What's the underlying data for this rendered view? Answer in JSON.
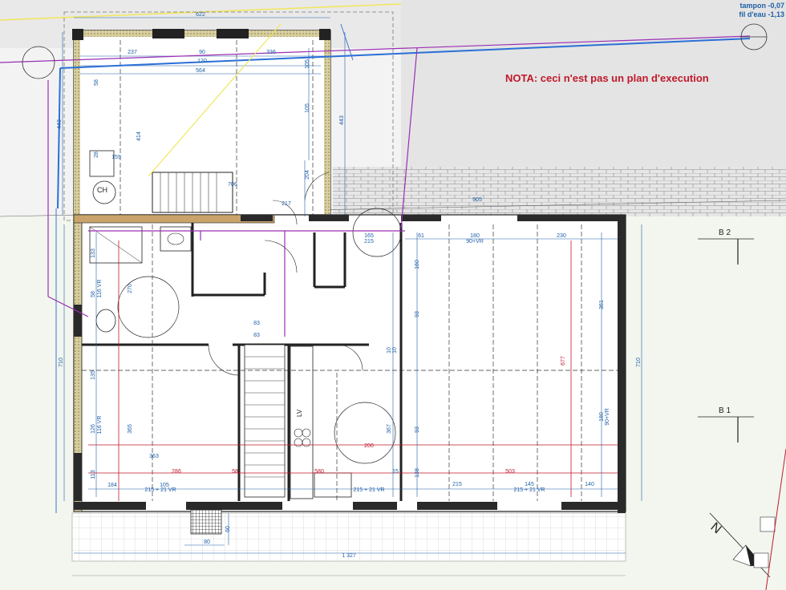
{
  "nota": "NOTA: ceci n'est pas un plan d'execution",
  "tampon": {
    "line1": "tampon -0,07",
    "line2": "fil d'eau -1,13"
  },
  "sections": {
    "b2": "B 2",
    "b1": "B 1"
  },
  "north": "N",
  "labels": {
    "ch": "CH",
    "lv": "LV"
  },
  "dims_blue": [
    {
      "t": "622"
    },
    {
      "t": "237"
    },
    {
      "t": "90"
    },
    {
      "t": "120"
    },
    {
      "t": "336"
    },
    {
      "t": "564"
    },
    {
      "t": "443"
    },
    {
      "t": "414"
    },
    {
      "t": "105"
    },
    {
      "t": "105"
    },
    {
      "t": "443"
    },
    {
      "t": "58"
    },
    {
      "t": "28"
    },
    {
      "t": "159"
    },
    {
      "t": "204"
    },
    {
      "t": "706"
    },
    {
      "t": "217"
    },
    {
      "t": "905"
    },
    {
      "t": "61"
    },
    {
      "t": "180"
    },
    {
      "t": "90+VR"
    },
    {
      "t": "230"
    },
    {
      "t": "165"
    },
    {
      "t": "215"
    },
    {
      "t": "133"
    },
    {
      "t": "270"
    },
    {
      "t": "58"
    },
    {
      "t": "116 VR"
    },
    {
      "t": "160"
    },
    {
      "t": "93"
    },
    {
      "t": "361"
    },
    {
      "t": "710"
    },
    {
      "t": "710"
    },
    {
      "t": "135"
    },
    {
      "t": "365"
    },
    {
      "t": "83"
    },
    {
      "t": "83"
    },
    {
      "t": "10"
    },
    {
      "t": "10"
    },
    {
      "t": "367"
    },
    {
      "t": "93"
    },
    {
      "t": "126"
    },
    {
      "t": "116 VR"
    },
    {
      "t": "180"
    },
    {
      "t": "90+VR"
    },
    {
      "t": "363"
    },
    {
      "t": "113"
    },
    {
      "t": "184"
    },
    {
      "t": "105"
    },
    {
      "t": "215 + 21 VR"
    },
    {
      "t": "215 + 21 VR"
    },
    {
      "t": "215"
    },
    {
      "t": "145"
    },
    {
      "t": "215 + 21 VR"
    },
    {
      "t": "140"
    },
    {
      "t": "138"
    },
    {
      "t": "15"
    },
    {
      "t": "60"
    },
    {
      "t": "80"
    },
    {
      "t": "1 327"
    }
  ],
  "dims_red": [
    {
      "t": "677"
    },
    {
      "t": "200"
    },
    {
      "t": "286"
    },
    {
      "t": "580"
    },
    {
      "t": "503"
    },
    {
      "t": "58"
    }
  ]
}
